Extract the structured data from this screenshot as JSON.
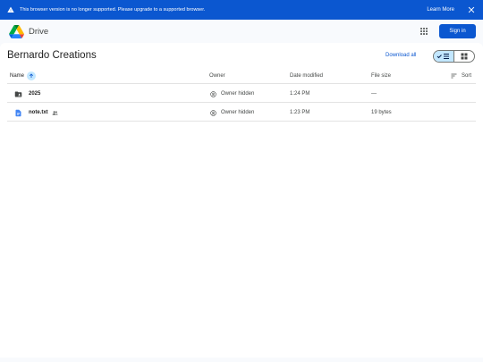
{
  "banner": {
    "message": "This browser version is no longer supported. Please upgrade to a supported browser.",
    "learn_more": "Learn More",
    "warning_icon": "warning-icon",
    "close_icon": "close-icon"
  },
  "topbar": {
    "brand": "Drive",
    "sign_in": "Sign in",
    "apps_icon": "apps-grid-icon"
  },
  "folder": {
    "title": "Bernardo Creations",
    "download_all": "Download all"
  },
  "columns": {
    "name": "Name",
    "owner": "Owner",
    "date_modified": "Date modified",
    "file_size": "File size",
    "sort": "Sort"
  },
  "files": [
    {
      "name": "2025",
      "type": "folder",
      "owner": "Owner hidden",
      "date_modified": "1:24 PM",
      "size": "—",
      "shared": false
    },
    {
      "name": "note.txt",
      "type": "document",
      "owner": "Owner hidden",
      "date_modified": "1:23 PM",
      "size": "19 bytes",
      "shared": true
    }
  ],
  "colors": {
    "accent": "#0b57d0",
    "toggle_active": "#c2e7ff",
    "background": "#f8fafd"
  }
}
